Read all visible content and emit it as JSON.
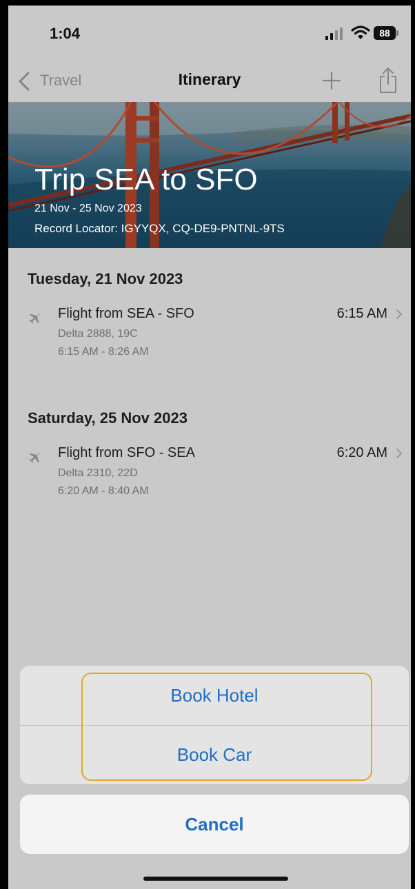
{
  "status_bar": {
    "time": "1:04",
    "battery": "88"
  },
  "nav": {
    "back_label": "Travel",
    "title": "Itinerary"
  },
  "trip": {
    "title": "Trip SEA to SFO",
    "dates": "21 Nov - 25 Nov 2023",
    "record_locator": "Record Locator: IGYYQX, CQ-DE9-PNTNL-9TS"
  },
  "days": [
    {
      "label": "Tuesday, 21 Nov 2023",
      "flight": {
        "title": "Flight from SEA - SFO",
        "details": "Delta 2888, 19C",
        "time_range": "6:15 AM - 8:26 AM",
        "time": "6:15 AM"
      }
    },
    {
      "label": "Saturday, 25 Nov 2023",
      "flight": {
        "title": "Flight from SFO - SEA",
        "details": "Delta 2310, 22D",
        "time_range": "6:20 AM - 8:40 AM",
        "time": "6:20 AM"
      }
    }
  ],
  "action_sheet": {
    "book_hotel": "Book Hotel",
    "book_car": "Book Car",
    "cancel": "Cancel"
  },
  "colors": {
    "accent": "#1f6ec7",
    "highlight": "#e2a72b",
    "background": "#c9c9c9"
  },
  "icons": {
    "back": "chevron-left-icon",
    "add": "plus-icon",
    "share": "share-icon",
    "flight": "airplane-icon",
    "row": "chevron-right-icon"
  }
}
